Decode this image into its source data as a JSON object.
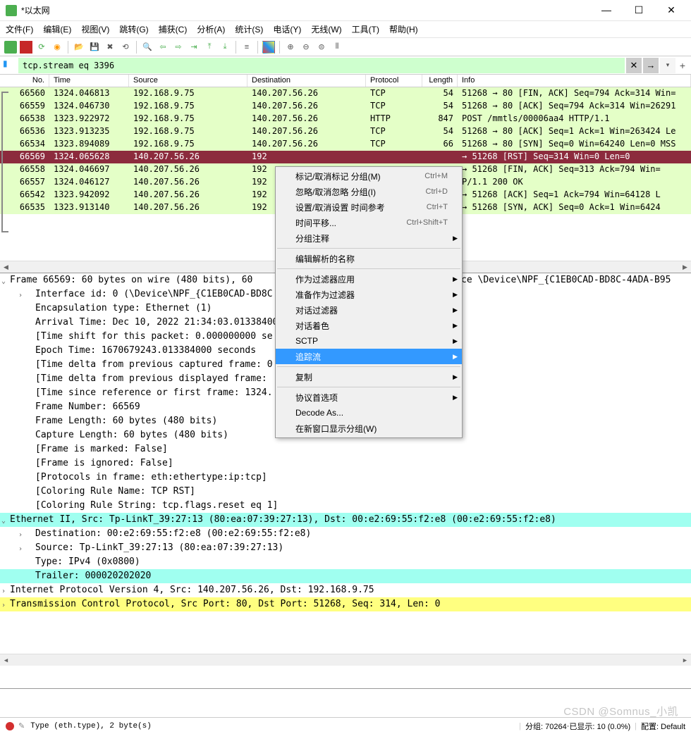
{
  "window": {
    "title": "*以太网"
  },
  "menus": [
    "文件(F)",
    "编辑(E)",
    "视图(V)",
    "跳转(G)",
    "捕获(C)",
    "分析(A)",
    "统计(S)",
    "电话(Y)",
    "无线(W)",
    "工具(T)",
    "帮助(H)"
  ],
  "filter": {
    "value": "tcp.stream eq 3396",
    "clear": "✕",
    "arrow": "→",
    "plus": "+"
  },
  "columns": {
    "no": "No.",
    "time": "Time",
    "src": "Source",
    "dst": "Destination",
    "proto": "Protocol",
    "len": "Length",
    "info": "Info"
  },
  "packets": [
    {
      "no": "66560",
      "time": "1324.046813",
      "src": "192.168.9.75",
      "dst": "140.207.56.26",
      "proto": "TCP",
      "len": "54",
      "info": "51268 → 80 [FIN, ACK] Seq=794 Ack=314 Win=",
      "cls": "lightgreen"
    },
    {
      "no": "66559",
      "time": "1324.046730",
      "src": "192.168.9.75",
      "dst": "140.207.56.26",
      "proto": "TCP",
      "len": "54",
      "info": "51268 → 80 [ACK] Seq=794 Ack=314 Win=26291",
      "cls": "lightgreen"
    },
    {
      "no": "66538",
      "time": "1323.922972",
      "src": "192.168.9.75",
      "dst": "140.207.56.26",
      "proto": "HTTP",
      "len": "847",
      "info": "POST /mmtls/00006aa4 HTTP/1.1",
      "cls": "lightgreen"
    },
    {
      "no": "66536",
      "time": "1323.913235",
      "src": "192.168.9.75",
      "dst": "140.207.56.26",
      "proto": "TCP",
      "len": "54",
      "info": "51268 → 80 [ACK] Seq=1 Ack=1 Win=263424 Le",
      "cls": "lightgreen"
    },
    {
      "no": "66534",
      "time": "1323.894089",
      "src": "192.168.9.75",
      "dst": "140.207.56.26",
      "proto": "TCP",
      "len": "66",
      "info": "51268 → 80 [SYN] Seq=0 Win=64240 Len=0 MSS",
      "cls": "lightgreen"
    },
    {
      "no": "66569",
      "time": "1324.065628",
      "src": "140.207.56.26",
      "dst": "192",
      "proto": "",
      "len": "",
      "info": "→ 51268 [RST] Seq=314 Win=0 Len=0",
      "cls": "selected"
    },
    {
      "no": "66558",
      "time": "1324.046697",
      "src": "140.207.56.26",
      "dst": "192",
      "proto": "",
      "len": "",
      "info": "→ 51268 [FIN, ACK] Seq=313 Ack=794 Win=",
      "cls": "lightgreen"
    },
    {
      "no": "66557",
      "time": "1324.046127",
      "src": "140.207.56.26",
      "dst": "192",
      "proto": "",
      "len": "",
      "info": "P/1.1 200 OK",
      "cls": "lightgreen"
    },
    {
      "no": "66542",
      "time": "1323.942092",
      "src": "140.207.56.26",
      "dst": "192",
      "proto": "",
      "len": "",
      "info": "→ 51268 [ACK] Seq=1 Ack=794 Win=64128 L",
      "cls": "lightgreen"
    },
    {
      "no": "66535",
      "time": "1323.913140",
      "src": "140.207.56.26",
      "dst": "192",
      "proto": "",
      "len": "",
      "info": "→ 51268 [SYN, ACK] Seq=0 Ack=1 Win=6424",
      "cls": "lightgreen"
    }
  ],
  "details": {
    "frame": "Frame 66569: 60 bytes on wire (480 bits), 60 ",
    "frame_tail": "ace \\Device\\NPF_{C1EB0CAD-BD8C-4ADA-B95",
    "iface": "Interface id: 0 (\\Device\\NPF_{C1EB0CAD-BD8C",
    "encap": "Encapsulation type: Ethernet (1)",
    "arrival": "Arrival Time: Dec 10, 2022 21:34:03.013384000",
    "tshift": "[Time shift for this packet: 0.000000000 se",
    "epoch": "Epoch Time: 1670679243.013384000 seconds",
    "delta1": "[Time delta from previous captured frame: 0",
    "delta2": "[Time delta from previous displayed frame: ",
    "since": "[Time since reference or first frame: 1324.",
    "fnum": "Frame Number: 66569",
    "flen": "Frame Length: 60 bytes (480 bits)",
    "clen": "Capture Length: 60 bytes (480 bits)",
    "marked": "[Frame is marked: False]",
    "ignored": "[Frame is ignored: False]",
    "protos": "[Protocols in frame: eth:ethertype:ip:tcp]",
    "crname": "[Coloring Rule Name: TCP RST]",
    "crstr": "[Coloring Rule String: tcp.flags.reset eq 1]",
    "eth": "Ethernet II, Src: Tp-LinkT_39:27:13 (80:ea:07:39:27:13), Dst: 00:e2:69:55:f2:e8 (00:e2:69:55:f2:e8)",
    "ethdst": "Destination: 00:e2:69:55:f2:e8 (00:e2:69:55:f2:e8)",
    "ethsrc": "Source: Tp-LinkT_39:27:13 (80:ea:07:39:27:13)",
    "ethtype": "Type: IPv4 (0x0800)",
    "trailer": "Trailer: 000020202020",
    "ip": "Internet Protocol Version 4, Src: 140.207.56.26, Dst: 192.168.9.75",
    "tcp": "Transmission Control Protocol, Src Port: 80, Dst Port: 51268, Seq: 314, Len: 0"
  },
  "ctx": {
    "mark": "标记/取消标记 分组(M)",
    "mark_k": "Ctrl+M",
    "ignore": "忽略/取消忽略 分组(I)",
    "ignore_k": "Ctrl+D",
    "timeref": "设置/取消设置 时间参考",
    "timeref_k": "Ctrl+T",
    "timeshift": "时间平移...",
    "timeshift_k": "Ctrl+Shift+T",
    "comment": "分组注释",
    "editname": "编辑解析的名称",
    "asfilter": "作为过滤器应用",
    "prepfilter": "准备作为过滤器",
    "convfilter": "对话过滤器",
    "convcolor": "对话着色",
    "sctp": "SCTP",
    "follow": "追踪流",
    "copy": "复制",
    "protoopts": "协议首选项",
    "decode": "Decode As...",
    "newwin": "在新窗口显示分组(W)"
  },
  "status": {
    "left": "Type (eth.type), 2 byte(s)",
    "pkts": "分组: 70264",
    "shown": "已显示: 10 (0.0%)",
    "profile": "配置: Default"
  },
  "watermark": "CSDN @Somnus_小凯"
}
